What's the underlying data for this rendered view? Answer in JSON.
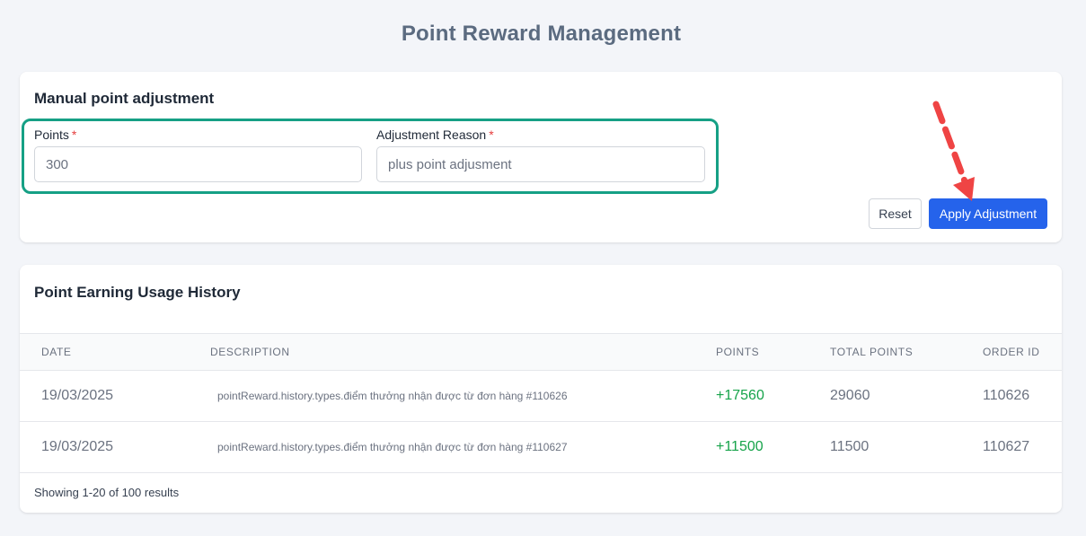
{
  "page": {
    "title": "Point Reward Management"
  },
  "adjustment": {
    "title": "Manual point adjustment",
    "points_label": "Points",
    "points_value": "300",
    "reason_label": "Adjustment Reason",
    "reason_placeholder": "plus point adjusment",
    "required_mark": "*",
    "reset_label": "Reset",
    "apply_label": "Apply Adjustment"
  },
  "history": {
    "title": "Point Earning Usage History",
    "columns": [
      "DATE",
      "DESCRIPTION",
      "POINTS",
      "TOTAL POINTS",
      "ORDER ID"
    ],
    "rows": [
      {
        "date": "19/03/2025",
        "description": "pointReward.history.types.điểm thưởng nhận được từ đơn hàng #110626",
        "points": "+17560",
        "total_points": "29060",
        "order_id": "110626"
      },
      {
        "date": "19/03/2025",
        "description": "pointReward.history.types.điểm thưởng nhận được từ đơn hàng #110627",
        "points": "+11500",
        "total_points": "11500",
        "order_id": "110627"
      }
    ],
    "footer": "Showing 1-20 of 100 results"
  },
  "colors": {
    "primary": "#2563eb",
    "highlight": "#16a085",
    "positive": "#16a34a",
    "required": "#e53e3e",
    "arrow": "#ef4444"
  },
  "icons": {
    "annotation_arrow": "dashed-arrow-icon"
  }
}
